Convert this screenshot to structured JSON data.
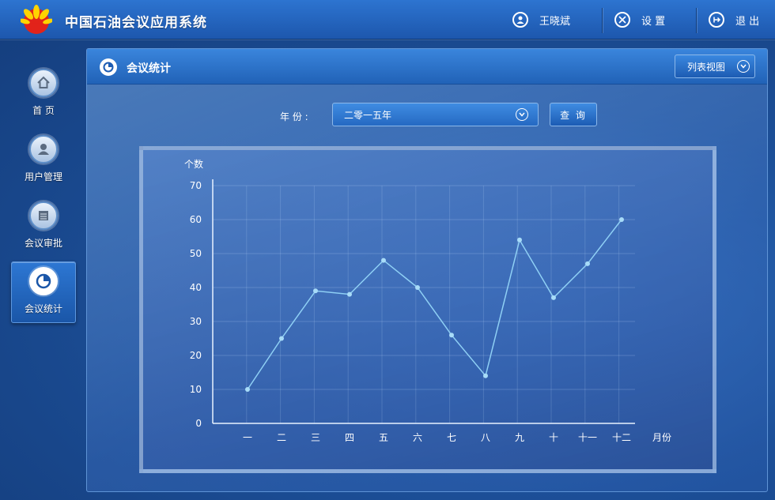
{
  "header": {
    "app_title": "中国石油会议应用系统",
    "user_name": "王晓斌",
    "settings_label": "设 置",
    "logout_label": "退 出"
  },
  "sidebar": {
    "items": [
      {
        "label": "首 页",
        "icon": "home-icon"
      },
      {
        "label": "用户管理",
        "icon": "user-icon"
      },
      {
        "label": "会议审批",
        "icon": "document-icon"
      },
      {
        "label": "会议统计",
        "icon": "pie-chart-icon",
        "active": true
      }
    ]
  },
  "panel": {
    "title": "会议统计",
    "view_button": "列表视图",
    "year_label": "年 份 :",
    "year_value": "二零一五年",
    "query_button": "查 询"
  },
  "chart_data": {
    "type": "line",
    "ylabel": "个数",
    "xlabel": "月份",
    "categories": [
      "一",
      "二",
      "三",
      "四",
      "五",
      "六",
      "七",
      "八",
      "九",
      "十",
      "十一",
      "十二"
    ],
    "values": [
      10,
      25,
      39,
      38,
      48,
      40,
      26,
      14,
      54,
      37,
      47,
      60
    ],
    "ylim": [
      0,
      70
    ],
    "yticks": [
      0,
      10,
      20,
      30,
      40,
      50,
      60,
      70
    ],
    "grid": true,
    "line_color": "#8fd0f5"
  },
  "colors": {
    "accent": "#2d74d0",
    "background": "#1c4f98"
  }
}
